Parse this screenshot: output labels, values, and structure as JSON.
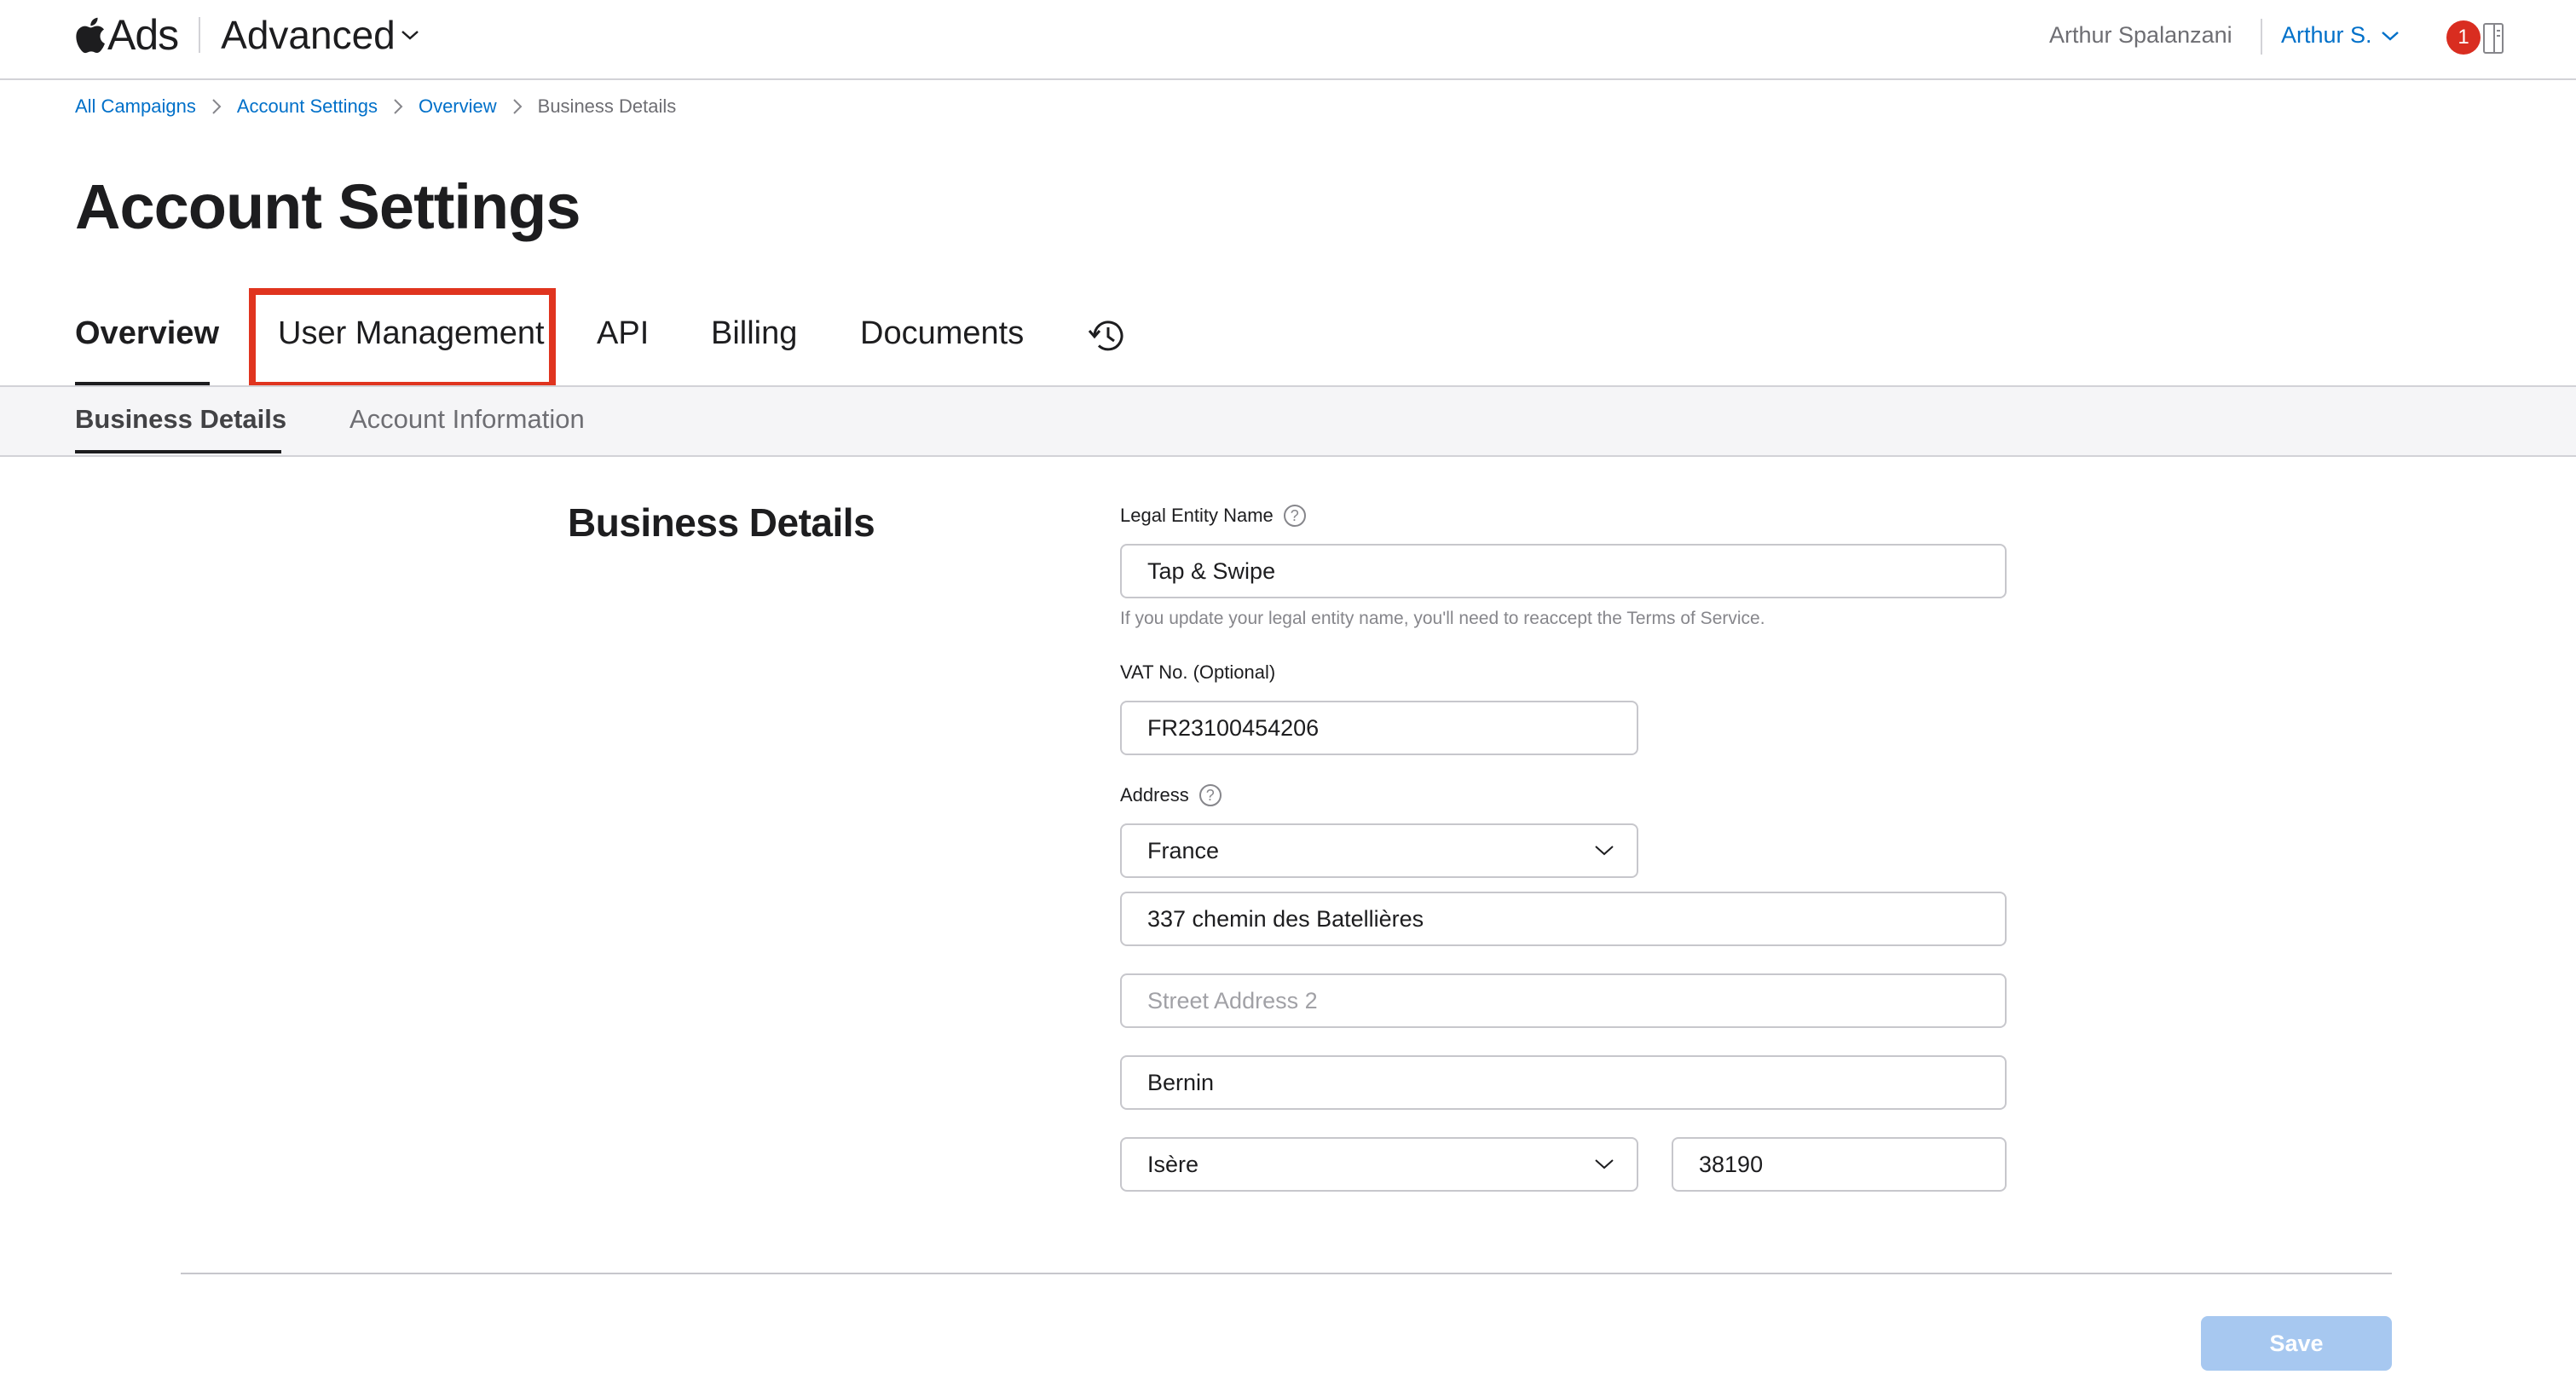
{
  "header": {
    "brand_name": "Ads",
    "product": "Advanced",
    "user_name": "Arthur Spalanzani",
    "user_menu": "Arthur S.",
    "notification_count": "1"
  },
  "breadcrumbs": [
    "All Campaigns",
    "Account Settings",
    "Overview",
    "Business Details"
  ],
  "page_title": "Account Settings",
  "tabs": [
    {
      "label": "Overview",
      "active": true
    },
    {
      "label": "User Management",
      "highlighted": true
    },
    {
      "label": "API"
    },
    {
      "label": "Billing"
    },
    {
      "label": "Documents"
    }
  ],
  "subtabs": [
    {
      "label": "Business Details",
      "active": true
    },
    {
      "label": "Account Information"
    }
  ],
  "section_title": "Business Details",
  "form": {
    "legal_entity_label": "Legal Entity Name",
    "legal_entity_value": "Tap & Swipe",
    "legal_entity_hint": "If you update your legal entity name, you'll need to reaccept the Terms of Service.",
    "vat_label": "VAT No. (Optional)",
    "vat_value": "FR23100454206",
    "address_label": "Address",
    "country": "France",
    "street1": "337 chemin des Batellières",
    "street2_placeholder": "Street Address 2",
    "city": "Bernin",
    "region": "Isère",
    "postal_code": "38190"
  },
  "save_label": "Save",
  "colors": {
    "link": "#0070c9",
    "highlight": "#e0341f",
    "notification": "#d92d20",
    "save_disabled": "#a7c8f0"
  }
}
